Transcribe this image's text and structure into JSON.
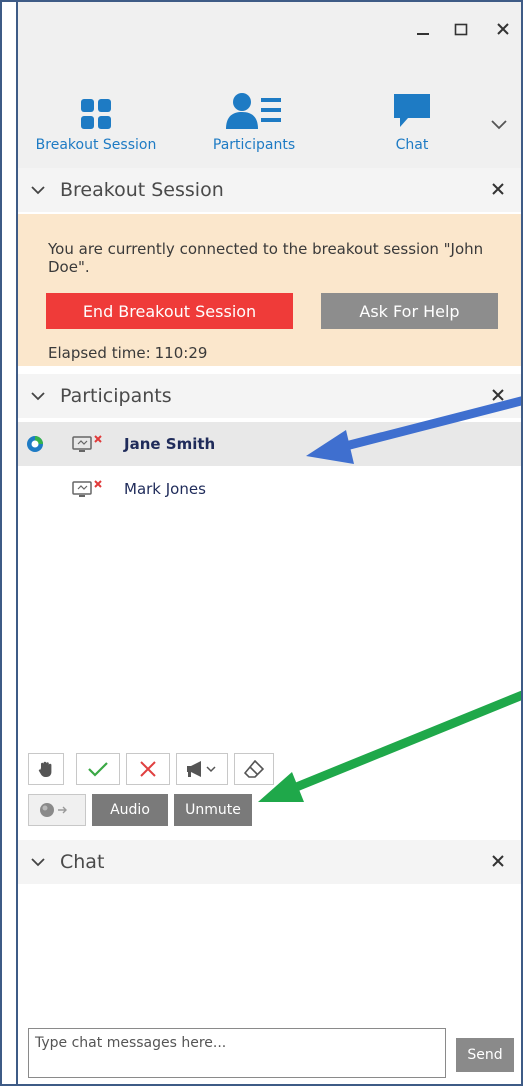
{
  "tabs": [
    {
      "label": "Breakout Session",
      "icon": "breakout-grid-icon"
    },
    {
      "label": "Participants",
      "icon": "participants-icon"
    },
    {
      "label": "Chat",
      "icon": "chat-bubble-icon"
    }
  ],
  "breakout": {
    "header": "Breakout Session",
    "notice": "You are currently connected to the breakout session \"John Doe\".",
    "end_label": "End Breakout Session",
    "help_label": "Ask For Help",
    "elapsed_label": "Elapsed time:",
    "elapsed_value": "110:29"
  },
  "participants": {
    "header": "Participants",
    "people": [
      {
        "name": "Jane Smith",
        "selected": true
      },
      {
        "name": "Mark Jones",
        "selected": false
      }
    ],
    "audio_label": "Audio",
    "unmute_label": "Unmute"
  },
  "chat": {
    "header": "Chat",
    "placeholder": "Type chat messages here...",
    "send_label": "Send"
  },
  "colors": {
    "accent": "#1e7bc4",
    "notice_bg": "#fbe7cc",
    "end_button": "#ef3b39",
    "arrow_blue": "#3f6fcf",
    "arrow_green": "#1fa84a"
  }
}
